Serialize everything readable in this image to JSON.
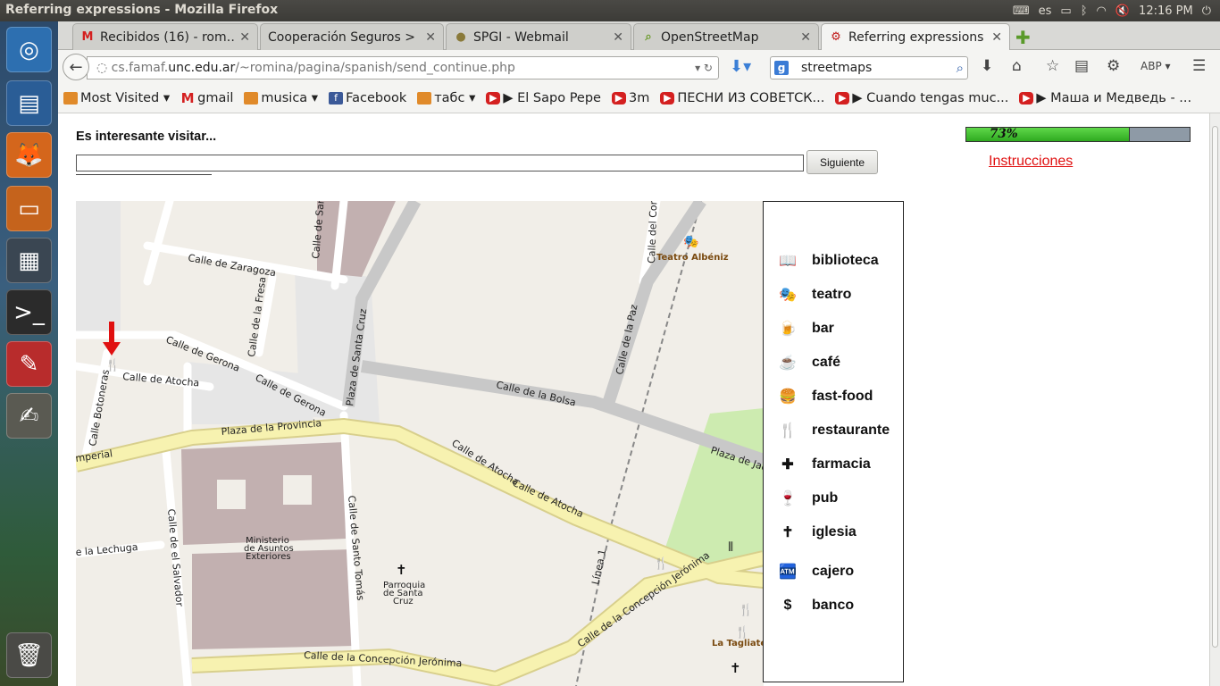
{
  "os": {
    "window_title": "Referring expressions - Mozilla Firefox",
    "keyboard_layout": "es",
    "clock": "12:16 PM"
  },
  "tabs": [
    {
      "label": "Recibidos (16) - rom…",
      "icon": "gmail-icon"
    },
    {
      "label": "Cooperación Seguros > …",
      "icon": ""
    },
    {
      "label": "SPGI - Webmail",
      "icon": "webmail-icon"
    },
    {
      "label": "OpenStreetMap",
      "icon": "magnifier-icon"
    },
    {
      "label": "Referring expressions",
      "icon": "referring-icon"
    }
  ],
  "urlbar": {
    "protocol_and_sub": "cs.famaf.",
    "domain": "unc.edu.ar",
    "path": "/~romina/pagina/spanish/send_continue.php"
  },
  "search": {
    "engine": "g",
    "value": "streetmaps"
  },
  "bookmarks": [
    {
      "label": "Most Visited ▾",
      "icon": "folder"
    },
    {
      "label": "gmail",
      "icon": "gm"
    },
    {
      "label": "musica ▾",
      "icon": "folder"
    },
    {
      "label": "Facebook",
      "icon": "fb"
    },
    {
      "label": "табс ▾",
      "icon": "folder"
    },
    {
      "label": "▶ El Sapo Pepe",
      "icon": "yt"
    },
    {
      "label": "3m",
      "icon": "yt"
    },
    {
      "label": "ПЕСНИ ИЗ СОВЕТСК...",
      "icon": "yt"
    },
    {
      "label": "▶ Cuando tengas muc...",
      "icon": "yt"
    },
    {
      "label": "▶ Маша и Медведь - ...",
      "icon": "yt"
    }
  ],
  "page": {
    "question": "Es interesante visitar...",
    "answer_value": "",
    "next_button": "Siguiente",
    "progress_text": "73%",
    "progress_value": 0.73,
    "instructions_link": "Instrucciones"
  },
  "map_labels": {
    "zaragoza": "Calle de Zaragoza",
    "san": "Calle de San",
    "gerona1": "Calle de Gerona",
    "gerona2": "Calle de Gerona",
    "atocha_small": "Calle de Atocha",
    "botoneras": "Calle Botoneras",
    "fresa": "Calle de la Fresa",
    "santa_cruz": "Plaza de Santa Cruz",
    "correo": "Calle del Correo",
    "teatro_albeniz": "Teatro Albéniz",
    "paz": "Calle de la Paz",
    "bolsa": "Calle de la Bolsa",
    "provincia": "Plaza de la Provincia",
    "imperial": "mperial",
    "atocha1": "Calle de Atocha",
    "atocha2": "Calle de Atocha",
    "jacinto": "Plaza de Jaci",
    "lechuga": "e la Lechuga",
    "salvador": "Calle de el Salvador",
    "santo_tomas": "Calle de Santo Tomás",
    "ministerio1": "Ministerio",
    "ministerio2": "de Asuntos",
    "ministerio3": "Exteriores",
    "parroquia1": "Parroquia",
    "parroquia2": "de Santa",
    "parroquia3": "Cruz",
    "linea": "Línea 1",
    "concepcion1": "Calle de la Concepción Jerónima",
    "concepcion2": "Calle de la Concepción Jerónima",
    "tagliate": "La Tagliate"
  },
  "legend": [
    {
      "label": "biblioteca",
      "icon": "library-icon",
      "glyph": "📖"
    },
    {
      "label": "teatro",
      "icon": "theatre-icon",
      "glyph": "🎭"
    },
    {
      "label": "bar",
      "icon": "bar-icon",
      "glyph": "🍺"
    },
    {
      "label": "café",
      "icon": "cafe-icon",
      "glyph": "☕"
    },
    {
      "label": "fast-food",
      "icon": "fastfood-icon",
      "glyph": "🍔"
    },
    {
      "label": "restaurante",
      "icon": "restaurant-icon",
      "glyph": "🍴"
    },
    {
      "label": "farmacia",
      "icon": "pharmacy-icon",
      "glyph": "✚"
    },
    {
      "label": "pub",
      "icon": "pub-icon",
      "glyph": "🍷"
    },
    {
      "label": "iglesia",
      "icon": "church-icon",
      "glyph": "✝"
    },
    {
      "label": "cajero",
      "icon": "atm-icon",
      "glyph": "🏧"
    },
    {
      "label": "banco",
      "icon": "bank-icon",
      "glyph": "$"
    }
  ]
}
